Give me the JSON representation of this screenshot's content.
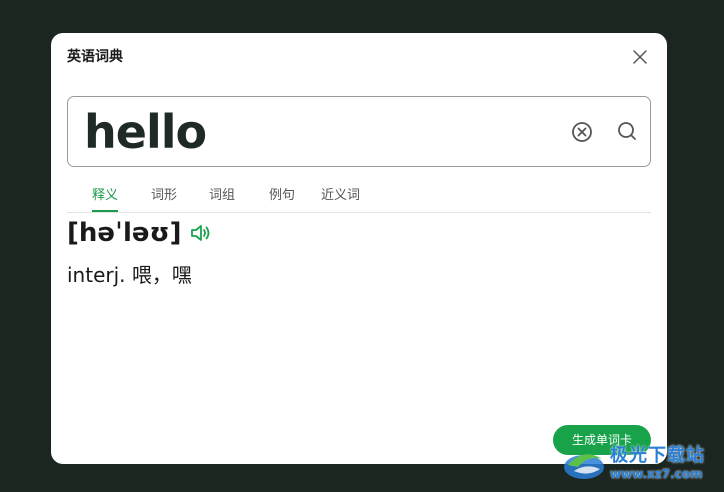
{
  "dialog": {
    "title": "英语词典",
    "close_icon": "close-icon"
  },
  "search": {
    "value": "hello",
    "clear_icon": "clear-circle-icon",
    "search_icon": "search-icon"
  },
  "tabs": [
    {
      "label": "释义",
      "active": true
    },
    {
      "label": "词形",
      "active": false
    },
    {
      "label": "词组",
      "active": false
    },
    {
      "label": "例句",
      "active": false
    },
    {
      "label": "近义词",
      "active": false
    }
  ],
  "entry": {
    "phonetic": "[həˈləʊ]",
    "speaker_icon": "speaker-icon",
    "definition": "interj. 喂，嘿"
  },
  "actions": {
    "make_card_label": "生成单词卡"
  },
  "watermark": {
    "name": "极光下载站",
    "url": "www.xz7.com"
  },
  "colors": {
    "accent": "#18a34a",
    "background": "#1b2620",
    "watermark": "#2a7fd6"
  }
}
